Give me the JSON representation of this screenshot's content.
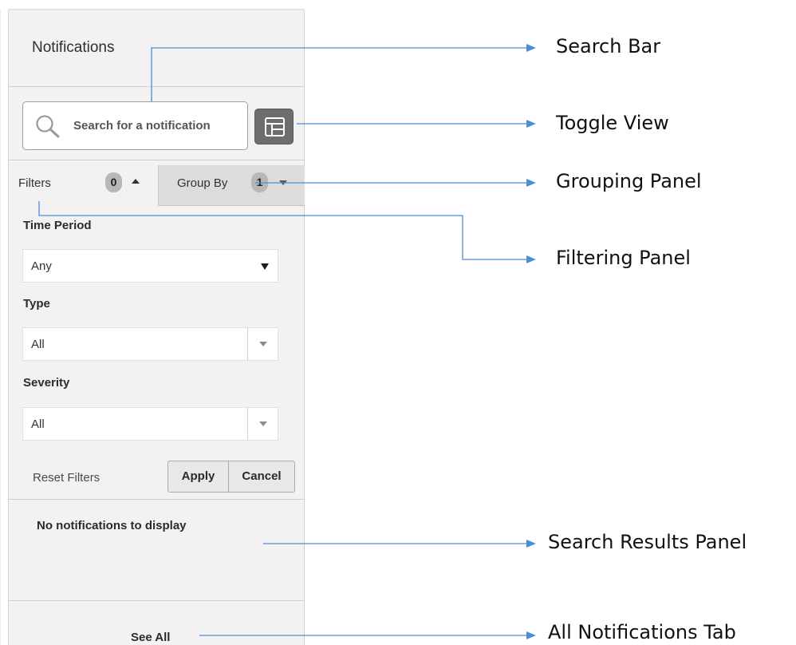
{
  "panel": {
    "title": "Notifications",
    "search": {
      "placeholder": "Search for a notification",
      "icon": "magnifier-icon"
    },
    "toggle_view": {
      "icon": "toggle-view-icon"
    },
    "tabs": {
      "filters": {
        "label": "Filters",
        "count": "0",
        "caret": "up"
      },
      "group_by": {
        "label": "Group By",
        "count": "1",
        "caret": "down"
      }
    },
    "filters": {
      "time_period": {
        "label": "Time Period",
        "value": "Any"
      },
      "type": {
        "label": "Type",
        "value": "All"
      },
      "severity": {
        "label": "Severity",
        "value": "All"
      },
      "reset_label": "Reset Filters",
      "apply_label": "Apply",
      "cancel_label": "Cancel"
    },
    "results": {
      "empty_message": "No notifications to display"
    },
    "footer": {
      "see_all_label": "See All"
    }
  },
  "annotations": {
    "search_bar": "Search Bar",
    "toggle_view": "Toggle View",
    "grouping_panel": "Grouping Panel",
    "filtering_panel": "Filtering Panel",
    "search_results_panel": "Search Results Panel",
    "all_notifications_tab": "All Notifications Tab"
  },
  "colors": {
    "panel_background": "#f2f2f2",
    "toggle_button": "#6d6d6d",
    "annotation_line": "#4a8fd6",
    "badge": "#b7b7b7"
  }
}
